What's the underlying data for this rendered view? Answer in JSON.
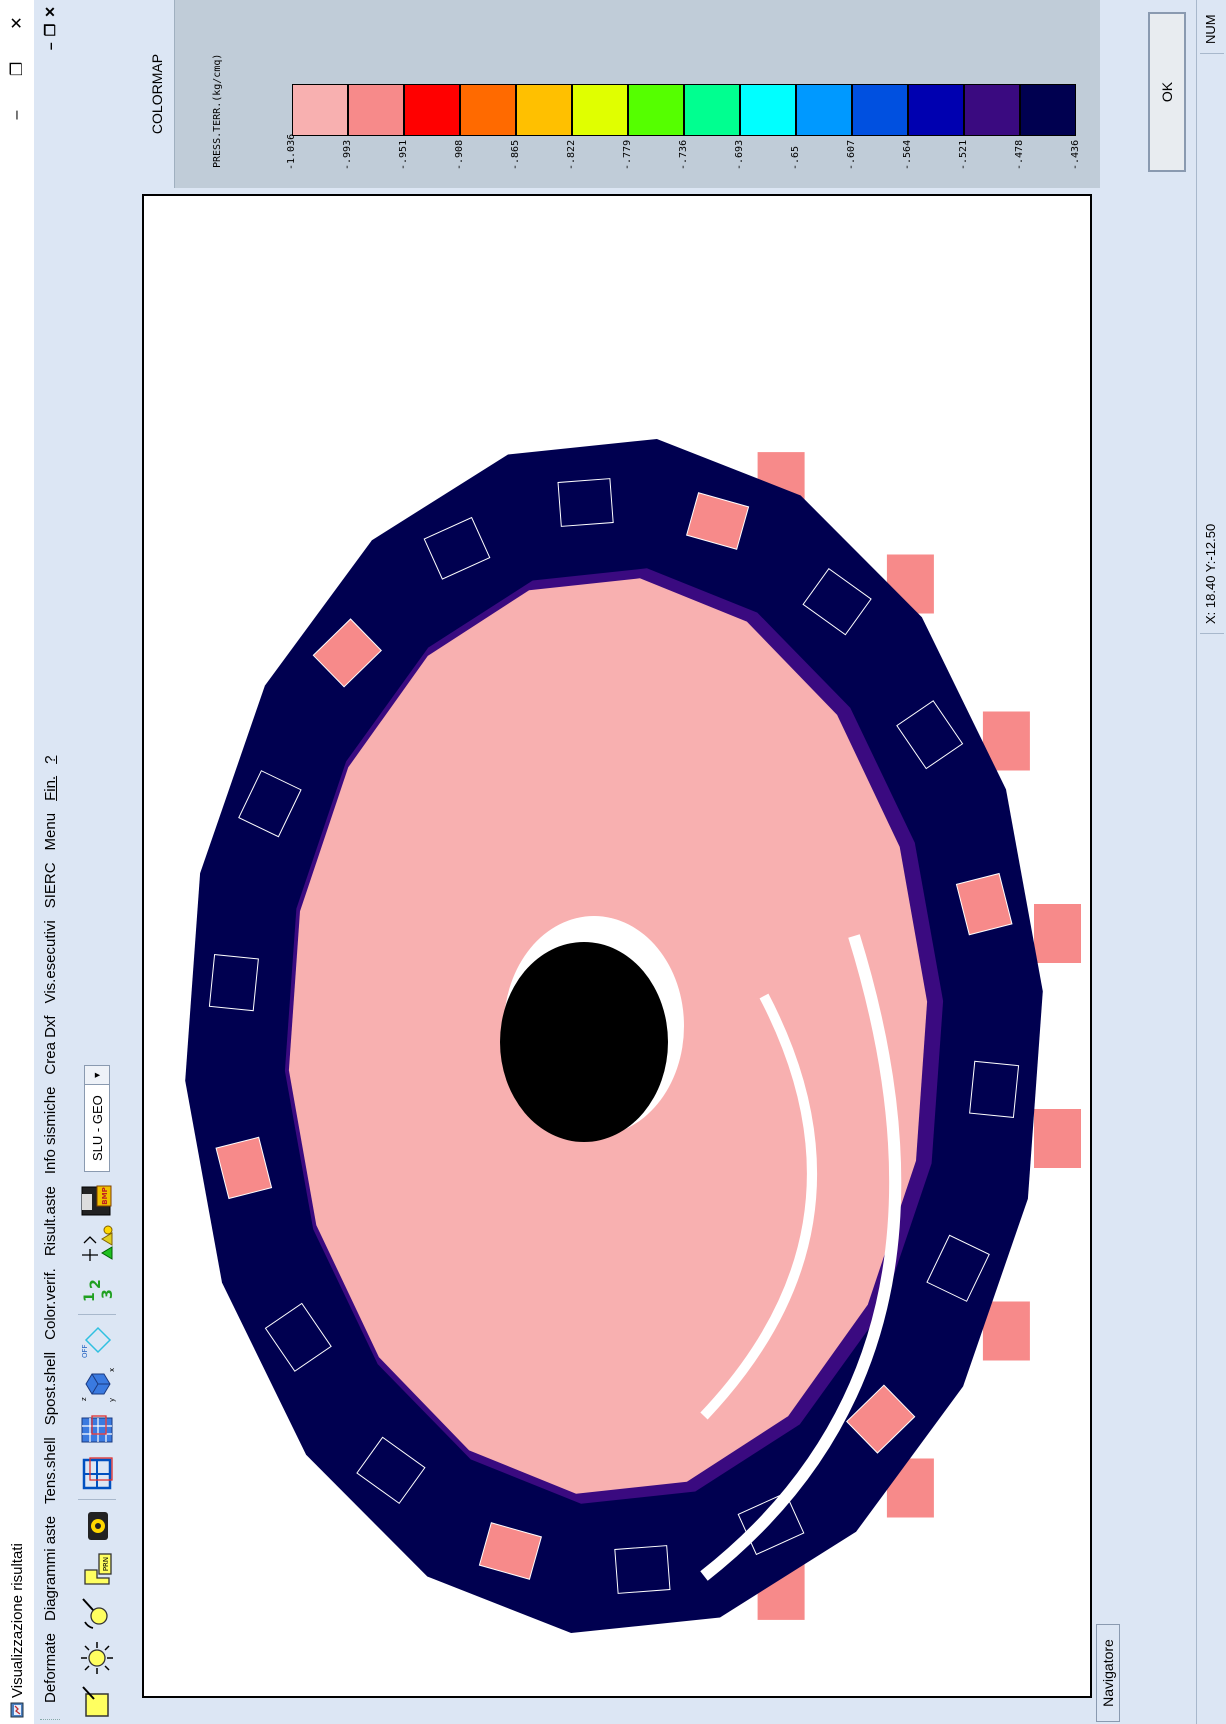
{
  "window": {
    "title": "Visualizzazione risultati",
    "minimize": "–",
    "restore": "❐",
    "close": "✕"
  },
  "menubar": {
    "items": [
      "Deformate",
      "Diagrammi aste",
      "Tens.shell",
      "Spost.shell",
      "Color.verif.",
      "Risult.aste",
      "Info sismiche",
      "Crea Dxf",
      "Vis.esecutivi",
      "SIERC",
      "Menu",
      "Fin.",
      "?"
    ],
    "mdi_minimize": "–",
    "mdi_restore": "❐",
    "mdi_close": "✕"
  },
  "toolbar": {
    "combo_value": "SLU - GEO",
    "combo_arrow": "▼",
    "bmp_label": "BMP",
    "off_label": "OFF",
    "numbering_label": "1 2 3",
    "pr_label": "PRN"
  },
  "colormap": {
    "tab_label": "COLORMAP",
    "title": "PRESS.TERR.(kg/cmq)",
    "labels": [
      "-1.036",
      "-.993",
      "-.951",
      "-.908",
      "-.865",
      "-.822",
      "-.779",
      "-.736",
      "-.693",
      "-.65",
      "-.607",
      "-.564",
      "-.521",
      "-.478",
      "-.436"
    ],
    "colors": [
      "#f8b0b0",
      "#f78a8a",
      "#ff0000",
      "#ff6a00",
      "#ffc000",
      "#e0ff00",
      "#55ff00",
      "#00ff90",
      "#00ffff",
      "#0099ff",
      "#0050e0",
      "#0000b0",
      "#3a0a80",
      "#000050"
    ],
    "ok_label": "OK"
  },
  "navigator": {
    "tab_label": "Navigatore"
  },
  "statusbar": {
    "coords": "X: 18.40  Y:-12.50",
    "num": "NUM"
  },
  "scene": {
    "slab_color": "#f8b0b0",
    "ring_color": "#000050",
    "ring_edge_color": "#3a0a80",
    "hole_color": "#000000",
    "pile_color": "#f78a8a"
  }
}
